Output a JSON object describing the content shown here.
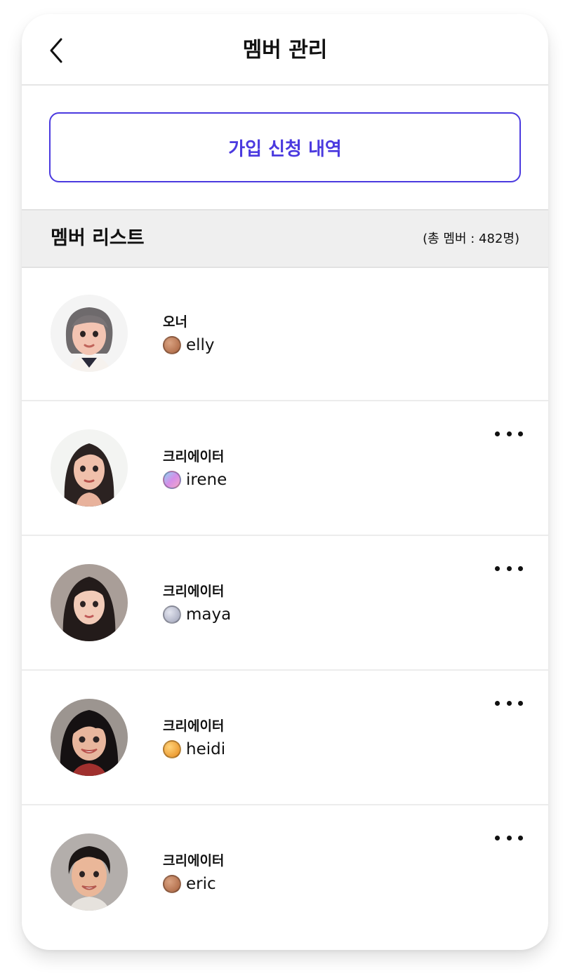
{
  "header": {
    "title": "멤버 관리",
    "back_icon": "chevron-left-icon"
  },
  "join_requests_button": {
    "label": "가입 신청 내역",
    "color": "#4b3adf"
  },
  "member_list": {
    "title": "멤버 리스트",
    "count_text": "(총 멤버 : 482명)"
  },
  "members": [
    {
      "role": "오너",
      "username": "elly",
      "badge": "bronze-badge-icon",
      "badge_color": "#b87a55",
      "more": false
    },
    {
      "role": "크리에이터",
      "username": "irene",
      "badge": "holo-badge-icon",
      "badge_color": "#c58de0",
      "more": true
    },
    {
      "role": "크리에이터",
      "username": "maya",
      "badge": "silver-badge-icon",
      "badge_color": "#b9bccb",
      "more": true
    },
    {
      "role": "크리에이터",
      "username": "heidi",
      "badge": "gold-badge-icon",
      "badge_color": "#f4a93a",
      "more": true
    },
    {
      "role": "크리에이터",
      "username": "eric",
      "badge": "bronze-badge-icon",
      "badge_color": "#b87a55",
      "more": true
    }
  ]
}
